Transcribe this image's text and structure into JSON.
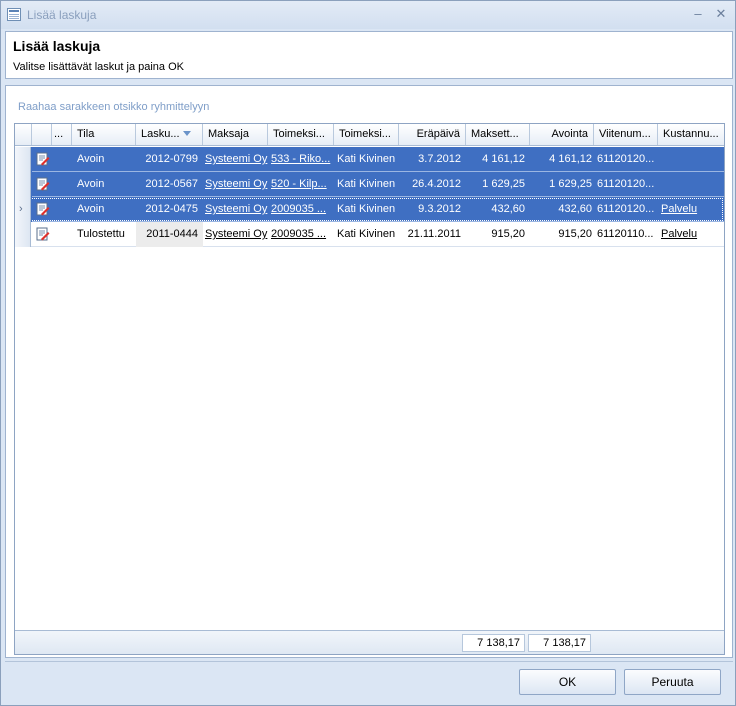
{
  "window": {
    "title": "Lisää laskuja"
  },
  "header": {
    "title": "Lisää laskuja",
    "subtitle": "Valitse lisättävät laskut ja paina OK"
  },
  "grid": {
    "group_hint": "Raahaa sarakkeen otsikko ryhmittelyyn",
    "columns": [
      "...",
      "Tila",
      "Lasku...",
      "Maksaja",
      "Toimeksi...",
      "Toimeksi...",
      "Eräpäivä",
      "Maksett...",
      "Avointa",
      "Viitenum...",
      "Kustannu..."
    ],
    "sorted_column": "Lasku...",
    "rows": [
      {
        "tila": "Avoin",
        "lasku": "2012-0799",
        "maksaja": "Systeemi Oy",
        "toimeksianto": "533 - Riko...",
        "toimeksisaaja": "Kati Kivinen",
        "erapaiva": "3.7.2012",
        "maksettava": "4 161,12",
        "avointa": "4 161,12",
        "viitenumero": "61120120...",
        "kustannus": ""
      },
      {
        "tila": "Avoin",
        "lasku": "2012-0567",
        "maksaja": "Systeemi Oy",
        "toimeksianto": "520 - Kilp...",
        "toimeksisaaja": "Kati Kivinen",
        "erapaiva": "26.4.2012",
        "maksettava": "1 629,25",
        "avointa": "1 629,25",
        "viitenumero": "61120120...",
        "kustannus": ""
      },
      {
        "tila": "Avoin",
        "lasku": "2012-0475",
        "maksaja": "Systeemi Oy",
        "toimeksianto": "2009035 ...",
        "toimeksisaaja": "Kati Kivinen",
        "erapaiva": "9.3.2012",
        "maksettava": "432,60",
        "avointa": "432,60",
        "viitenumero": "61120120...",
        "kustannus": "Palvelu"
      },
      {
        "tila": "Tulostettu",
        "lasku": "2011-0444",
        "maksaja": "Systeemi Oy",
        "toimeksianto": "2009035 ...",
        "toimeksisaaja": "Kati Kivinen",
        "erapaiva": "21.11.2011",
        "maksettava": "915,20",
        "avointa": "915,20",
        "viitenumero": "61120110...",
        "kustannus": "Palvelu"
      }
    ],
    "totals": {
      "maksettava": "7 138,17",
      "avointa": "7 138,17"
    }
  },
  "buttons": {
    "ok": "OK",
    "cancel": "Peruuta"
  },
  "colors": {
    "selection": "#3f6fc2",
    "accent": "#6a93c9",
    "window_bg": "#dbe6f4"
  }
}
